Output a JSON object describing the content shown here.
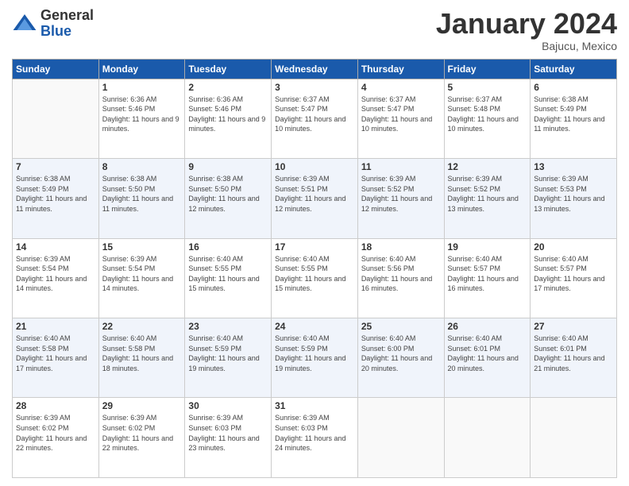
{
  "logo": {
    "general": "General",
    "blue": "Blue"
  },
  "title": "January 2024",
  "location": "Bajucu, Mexico",
  "days_header": [
    "Sunday",
    "Monday",
    "Tuesday",
    "Wednesday",
    "Thursday",
    "Friday",
    "Saturday"
  ],
  "weeks": [
    [
      {
        "day": "",
        "sunrise": "",
        "sunset": "",
        "daylight": ""
      },
      {
        "day": "1",
        "sunrise": "Sunrise: 6:36 AM",
        "sunset": "Sunset: 5:46 PM",
        "daylight": "Daylight: 11 hours and 9 minutes."
      },
      {
        "day": "2",
        "sunrise": "Sunrise: 6:36 AM",
        "sunset": "Sunset: 5:46 PM",
        "daylight": "Daylight: 11 hours and 9 minutes."
      },
      {
        "day": "3",
        "sunrise": "Sunrise: 6:37 AM",
        "sunset": "Sunset: 5:47 PM",
        "daylight": "Daylight: 11 hours and 10 minutes."
      },
      {
        "day": "4",
        "sunrise": "Sunrise: 6:37 AM",
        "sunset": "Sunset: 5:47 PM",
        "daylight": "Daylight: 11 hours and 10 minutes."
      },
      {
        "day": "5",
        "sunrise": "Sunrise: 6:37 AM",
        "sunset": "Sunset: 5:48 PM",
        "daylight": "Daylight: 11 hours and 10 minutes."
      },
      {
        "day": "6",
        "sunrise": "Sunrise: 6:38 AM",
        "sunset": "Sunset: 5:49 PM",
        "daylight": "Daylight: 11 hours and 11 minutes."
      }
    ],
    [
      {
        "day": "7",
        "sunrise": "Sunrise: 6:38 AM",
        "sunset": "Sunset: 5:49 PM",
        "daylight": "Daylight: 11 hours and 11 minutes."
      },
      {
        "day": "8",
        "sunrise": "Sunrise: 6:38 AM",
        "sunset": "Sunset: 5:50 PM",
        "daylight": "Daylight: 11 hours and 11 minutes."
      },
      {
        "day": "9",
        "sunrise": "Sunrise: 6:38 AM",
        "sunset": "Sunset: 5:50 PM",
        "daylight": "Daylight: 11 hours and 12 minutes."
      },
      {
        "day": "10",
        "sunrise": "Sunrise: 6:39 AM",
        "sunset": "Sunset: 5:51 PM",
        "daylight": "Daylight: 11 hours and 12 minutes."
      },
      {
        "day": "11",
        "sunrise": "Sunrise: 6:39 AM",
        "sunset": "Sunset: 5:52 PM",
        "daylight": "Daylight: 11 hours and 12 minutes."
      },
      {
        "day": "12",
        "sunrise": "Sunrise: 6:39 AM",
        "sunset": "Sunset: 5:52 PM",
        "daylight": "Daylight: 11 hours and 13 minutes."
      },
      {
        "day": "13",
        "sunrise": "Sunrise: 6:39 AM",
        "sunset": "Sunset: 5:53 PM",
        "daylight": "Daylight: 11 hours and 13 minutes."
      }
    ],
    [
      {
        "day": "14",
        "sunrise": "Sunrise: 6:39 AM",
        "sunset": "Sunset: 5:54 PM",
        "daylight": "Daylight: 11 hours and 14 minutes."
      },
      {
        "day": "15",
        "sunrise": "Sunrise: 6:39 AM",
        "sunset": "Sunset: 5:54 PM",
        "daylight": "Daylight: 11 hours and 14 minutes."
      },
      {
        "day": "16",
        "sunrise": "Sunrise: 6:40 AM",
        "sunset": "Sunset: 5:55 PM",
        "daylight": "Daylight: 11 hours and 15 minutes."
      },
      {
        "day": "17",
        "sunrise": "Sunrise: 6:40 AM",
        "sunset": "Sunset: 5:55 PM",
        "daylight": "Daylight: 11 hours and 15 minutes."
      },
      {
        "day": "18",
        "sunrise": "Sunrise: 6:40 AM",
        "sunset": "Sunset: 5:56 PM",
        "daylight": "Daylight: 11 hours and 16 minutes."
      },
      {
        "day": "19",
        "sunrise": "Sunrise: 6:40 AM",
        "sunset": "Sunset: 5:57 PM",
        "daylight": "Daylight: 11 hours and 16 minutes."
      },
      {
        "day": "20",
        "sunrise": "Sunrise: 6:40 AM",
        "sunset": "Sunset: 5:57 PM",
        "daylight": "Daylight: 11 hours and 17 minutes."
      }
    ],
    [
      {
        "day": "21",
        "sunrise": "Sunrise: 6:40 AM",
        "sunset": "Sunset: 5:58 PM",
        "daylight": "Daylight: 11 hours and 17 minutes."
      },
      {
        "day": "22",
        "sunrise": "Sunrise: 6:40 AM",
        "sunset": "Sunset: 5:58 PM",
        "daylight": "Daylight: 11 hours and 18 minutes."
      },
      {
        "day": "23",
        "sunrise": "Sunrise: 6:40 AM",
        "sunset": "Sunset: 5:59 PM",
        "daylight": "Daylight: 11 hours and 19 minutes."
      },
      {
        "day": "24",
        "sunrise": "Sunrise: 6:40 AM",
        "sunset": "Sunset: 5:59 PM",
        "daylight": "Daylight: 11 hours and 19 minutes."
      },
      {
        "day": "25",
        "sunrise": "Sunrise: 6:40 AM",
        "sunset": "Sunset: 6:00 PM",
        "daylight": "Daylight: 11 hours and 20 minutes."
      },
      {
        "day": "26",
        "sunrise": "Sunrise: 6:40 AM",
        "sunset": "Sunset: 6:01 PM",
        "daylight": "Daylight: 11 hours and 20 minutes."
      },
      {
        "day": "27",
        "sunrise": "Sunrise: 6:40 AM",
        "sunset": "Sunset: 6:01 PM",
        "daylight": "Daylight: 11 hours and 21 minutes."
      }
    ],
    [
      {
        "day": "28",
        "sunrise": "Sunrise: 6:39 AM",
        "sunset": "Sunset: 6:02 PM",
        "daylight": "Daylight: 11 hours and 22 minutes."
      },
      {
        "day": "29",
        "sunrise": "Sunrise: 6:39 AM",
        "sunset": "Sunset: 6:02 PM",
        "daylight": "Daylight: 11 hours and 22 minutes."
      },
      {
        "day": "30",
        "sunrise": "Sunrise: 6:39 AM",
        "sunset": "Sunset: 6:03 PM",
        "daylight": "Daylight: 11 hours and 23 minutes."
      },
      {
        "day": "31",
        "sunrise": "Sunrise: 6:39 AM",
        "sunset": "Sunset: 6:03 PM",
        "daylight": "Daylight: 11 hours and 24 minutes."
      },
      {
        "day": "",
        "sunrise": "",
        "sunset": "",
        "daylight": ""
      },
      {
        "day": "",
        "sunrise": "",
        "sunset": "",
        "daylight": ""
      },
      {
        "day": "",
        "sunrise": "",
        "sunset": "",
        "daylight": ""
      }
    ]
  ]
}
